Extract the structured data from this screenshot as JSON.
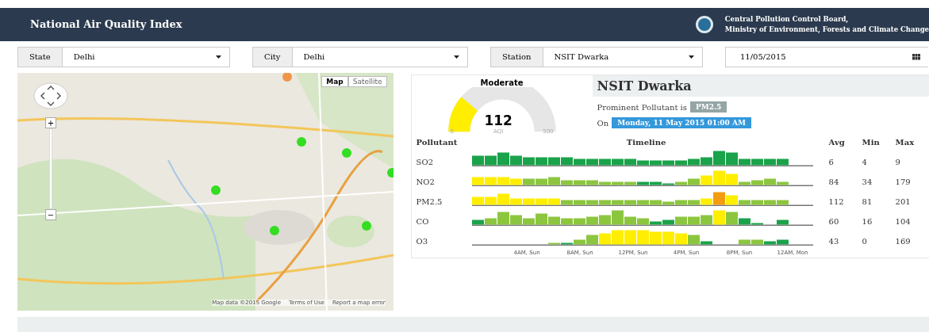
{
  "header": {
    "title": "National Air Quality Index",
    "org_line_1": "Central Pollution Control Board,",
    "org_line_2": "Ministry of Environment, Forests and Climate Change"
  },
  "filters": [
    {
      "label": "State",
      "value": "Delhi",
      "kind": "select"
    },
    {
      "label": "City",
      "value": "Delhi",
      "kind": "select"
    },
    {
      "label": "Station",
      "value": "NSIT Dwarka",
      "kind": "select"
    },
    {
      "value": "11/05/2015",
      "kind": "date"
    }
  ],
  "map": {
    "type_buttons": [
      {
        "label": "Map",
        "selected": true
      },
      {
        "label": "Satellite",
        "selected": false
      }
    ],
    "zoom_in": "+",
    "zoom_out": "−",
    "attribution": "Map data ©2015 Google",
    "terms": "Terms of Use",
    "report": "Report a map error",
    "markers": [
      {
        "color": "#f0954a"
      },
      {
        "color": "#33dd22"
      },
      {
        "color": "#33dd22"
      },
      {
        "color": "#33dd22"
      },
      {
        "color": "#33dd22"
      },
      {
        "color": "#33dd22"
      },
      {
        "color": "#33dd22"
      }
    ]
  },
  "gauge": {
    "category": "Moderate",
    "value": "112",
    "min": "0",
    "unit": "AQI",
    "max": "500"
  },
  "station": {
    "name": "NSIT Dwarka",
    "prominent_label": "Prominent Pollutant is",
    "prominent": "PM2.5",
    "on_label": "On",
    "datetime": "Monday, 11 May 2015 01:00 AM"
  },
  "table": {
    "columns": [
      "Pollutant",
      "Timeline",
      "Avg",
      "Min",
      "Max"
    ],
    "rows": [
      {
        "pollutant": "SO2",
        "avg": "6",
        "min": "4",
        "max": "9"
      },
      {
        "pollutant": "NO2",
        "avg": "84",
        "min": "34",
        "max": "179"
      },
      {
        "pollutant": "PM2.5",
        "avg": "112",
        "min": "81",
        "max": "201"
      },
      {
        "pollutant": "CO",
        "avg": "60",
        "min": "16",
        "max": "104"
      },
      {
        "pollutant": "O3",
        "avg": "43",
        "min": "0",
        "max": "169"
      }
    ],
    "time_ticks": [
      "4AM, Sun",
      "8AM, Sun",
      "12PM, Sun",
      "4PM, Sun",
      "8PM, Sun",
      "12AM, Mon"
    ]
  }
}
